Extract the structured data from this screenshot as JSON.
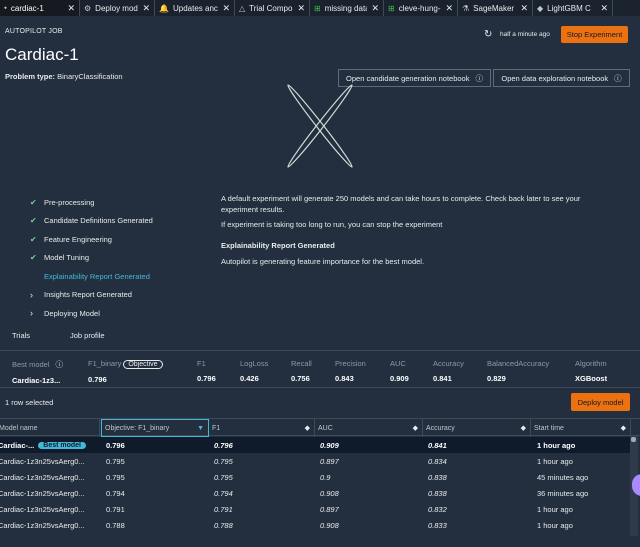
{
  "tabs": [
    {
      "icon": "⬩",
      "label": "cardiac-1",
      "active": true
    },
    {
      "icon": "⚙",
      "label": "Deploy mod"
    },
    {
      "icon": "🔔",
      "label": "Updates anc"
    },
    {
      "icon": "△",
      "label": "Trial Compo"
    },
    {
      "icon": "⊞",
      "label": "missing data",
      "green": true
    },
    {
      "icon": "⊞",
      "label": "cleve-hung-",
      "green": true
    },
    {
      "icon": "⚗",
      "label": "SageMaker ."
    },
    {
      "icon": "◆",
      "label": "LightGBM C"
    }
  ],
  "tab_close": "✕",
  "header": {
    "section_label": "AUTOPILOT JOB",
    "title": "Cardiac-1",
    "problem_type_label": "Problem type:",
    "problem_type_value": "BinaryClassification",
    "refresh_time": "half a minute ago",
    "stop_button": "Stop Experiment",
    "candidate_button": "Open candidate generation notebook",
    "exploration_button": "Open data exploration notebook",
    "info_icon": "ⓘ"
  },
  "steps": [
    {
      "label": "Pre-processing",
      "state": "done"
    },
    {
      "label": "Candidate Definitions Generated",
      "state": "done"
    },
    {
      "label": "Feature Engineering",
      "state": "done"
    },
    {
      "label": "Model Tuning",
      "state": "done"
    },
    {
      "label": "Explainability Report Generated",
      "state": "active"
    },
    {
      "label": "Insights Report Generated",
      "state": "pending"
    },
    {
      "label": "Deploying Model",
      "state": "pending"
    }
  ],
  "messages": {
    "line1": "A default experiment will generate 250 models and can take hours to complete. Check back later to see your",
    "line2": "experiment results.",
    "line3": "If experiment is taking too long to run, you can stop the experiment",
    "heading": "Explainability Report Generated",
    "line4": "Autopilot is generating feature importance for the best model."
  },
  "subtabs": {
    "trials": "Trials",
    "job_profile": "Job profile"
  },
  "best_model": {
    "headers": [
      "Best model",
      "F1_binary",
      "F1",
      "LogLoss",
      "Recall",
      "Precision",
      "AUC",
      "Accuracy",
      "BalancedAccuracy",
      "Algorithm"
    ],
    "objective_badge": "Objective",
    "values": [
      "Cardiac-1z3...",
      "0.796",
      "0.796",
      "0.426",
      "0.756",
      "0.843",
      "0.909",
      "0.841",
      "0.829",
      "XGBoost"
    ]
  },
  "table": {
    "selected_text": "1 row selected",
    "deploy_button": "Deploy model",
    "headers": [
      "Model name",
      "Objective: F1_binary",
      "F1",
      "AUC",
      "Accuracy",
      "Start time"
    ],
    "best_badge": "Best model",
    "rows": [
      {
        "name": "Cardiac-...",
        "objective": "0.796",
        "f1": "0.796",
        "auc": "0.909",
        "accuracy": "0.841",
        "start": "1 hour ago"
      },
      {
        "name": "Cardiac-1z3n25vsAerg0...",
        "objective": "0.795",
        "f1": "0.795",
        "auc": "0.897",
        "accuracy": "0.834",
        "start": "1 hour ago"
      },
      {
        "name": "Cardiac-1z3n25vsAerg0...",
        "objective": "0.795",
        "f1": "0.795",
        "auc": "0.9",
        "accuracy": "0.838",
        "start": "45 minutes ago"
      },
      {
        "name": "Cardiac-1z3n25vsAerg0...",
        "objective": "0.794",
        "f1": "0.794",
        "auc": "0.908",
        "accuracy": "0.838",
        "start": "36 minutes ago"
      },
      {
        "name": "Cardiac-1z3n25vsAerg0...",
        "objective": "0.791",
        "f1": "0.791",
        "auc": "0.897",
        "accuracy": "0.832",
        "start": "1 hour ago"
      },
      {
        "name": "Cardiac-1z3n25vsAerg0...",
        "objective": "0.788",
        "f1": "0.788",
        "auc": "0.908",
        "accuracy": "0.833",
        "start": "1 hour ago"
      }
    ]
  },
  "colors": {
    "accent": "#ec7211",
    "link": "#44b9d6",
    "success": "#6fd18a",
    "background": "#232f3e"
  }
}
